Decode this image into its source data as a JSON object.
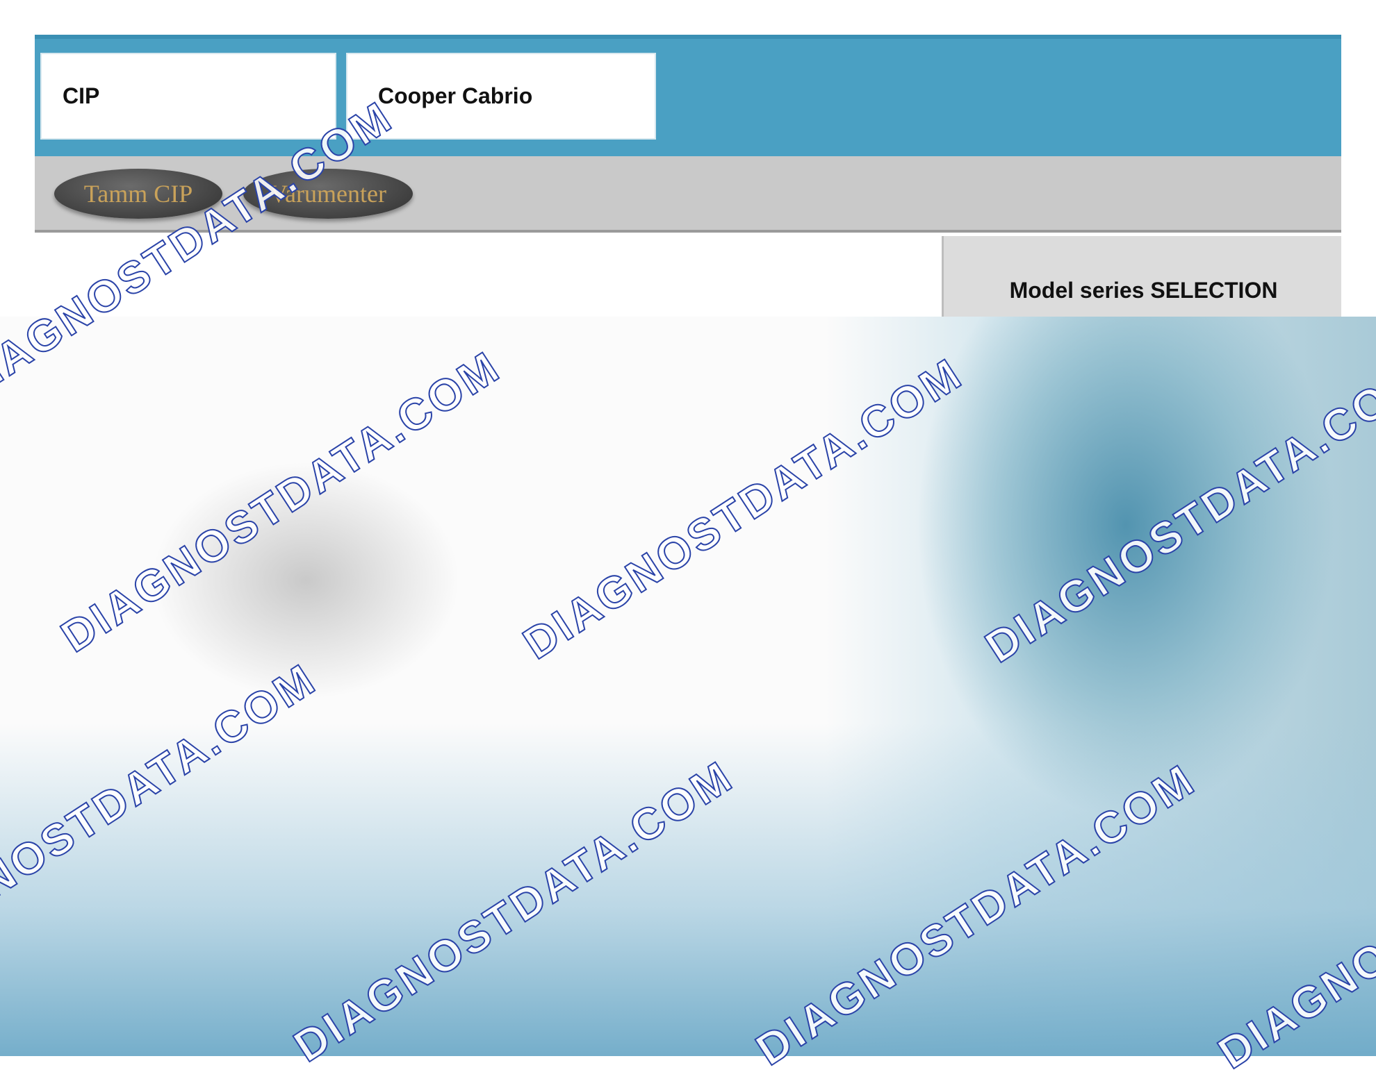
{
  "header": {
    "field_1": "CIP",
    "field_2": "Cooper Cabrio"
  },
  "toolbar": {
    "button_1_label": "Tamm CIP",
    "button_2_label": "Varumenter"
  },
  "side_panel": {
    "title": "Model series SELECTION"
  },
  "watermark": {
    "text": "DIAGNOSTDATA.COM"
  },
  "colors": {
    "header_blue": "#4aa0c3",
    "toolbar_gray": "#c9c9c9",
    "button_text_gold": "#c9a25a",
    "watermark_outline": "#2a43a8"
  }
}
